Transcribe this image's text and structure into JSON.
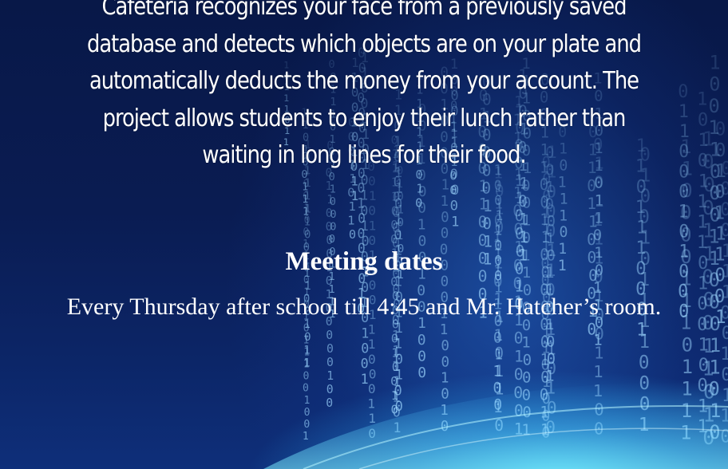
{
  "slide": {
    "description": "Cafeteria recognizes your face from a previously saved database and detects which objects are on your plate and automatically deducts the money from your account. The project allows students to enjoy their lunch rather than waiting in long lines for their food.",
    "meeting_heading": "Meeting dates",
    "meeting_details": "Every Thursday after school till 4:45 and Mr. Hatcher’s room."
  },
  "background": {
    "style": "binary-code-rain",
    "colors": {
      "base": "#0a1c52",
      "glow": "#5ae6ff",
      "digits": "#9fd8ff",
      "text": "#ffffff"
    }
  }
}
